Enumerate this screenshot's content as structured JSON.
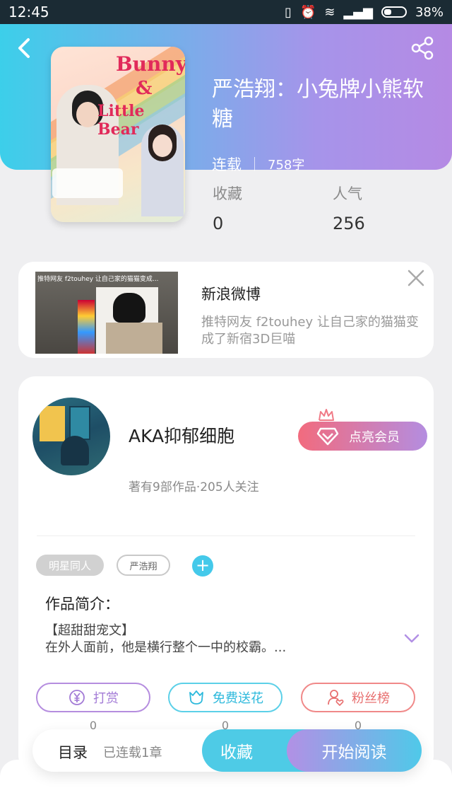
{
  "status_bar": {
    "time": "12:45",
    "battery": "38%"
  },
  "header": {
    "back_icon": "chevron-left-icon",
    "share_icon": "share-icon"
  },
  "cover": {
    "title_line1": "Bunny",
    "title_line2": "&",
    "title_line3": "Little Bear"
  },
  "book": {
    "title": "严浩翔：小兔牌小熊软糖",
    "status": "连载",
    "word_count": "758字",
    "stats": [
      {
        "label": "收藏",
        "value": "0"
      },
      {
        "label": "人气",
        "value": "256"
      }
    ]
  },
  "ad": {
    "thumb_caption": "推特网友 f2touhey 让自己家的猫猫变成...",
    "source": "新浪微博",
    "description": "推特网友 f2touhey 让自己家的猫猫变成了新宿3D巨喵",
    "close_icon": "close-icon"
  },
  "author": {
    "name": "AKA抑郁细胞",
    "info": "著有9部作品·205人关注",
    "vip_button": "点亮会员"
  },
  "tags": {
    "category": "明星同人",
    "tag1": "严浩翔",
    "add": "+"
  },
  "intro": {
    "title": "作品简介：",
    "line1": "【超甜甜宠文】",
    "line2": "在外人面前，他是横行整个一中的校霸。..."
  },
  "actions": [
    {
      "label": "打赏",
      "count": "0",
      "icon": "yen-icon"
    },
    {
      "label": "免费送花",
      "count": "0",
      "icon": "flower-icon"
    },
    {
      "label": "粉丝榜",
      "count": "0",
      "icon": "fans-icon"
    }
  ],
  "bottom": {
    "toc": "目录",
    "toc_status": "已连载1章",
    "fav": "收藏",
    "read": "开始阅读"
  },
  "colors": {
    "header_start": "#3ccfea",
    "header_end": "#b58ae4",
    "accent_cyan": "#4ecbe6",
    "accent_purple": "#b290e5",
    "vip_pink": "#f26b7e"
  }
}
